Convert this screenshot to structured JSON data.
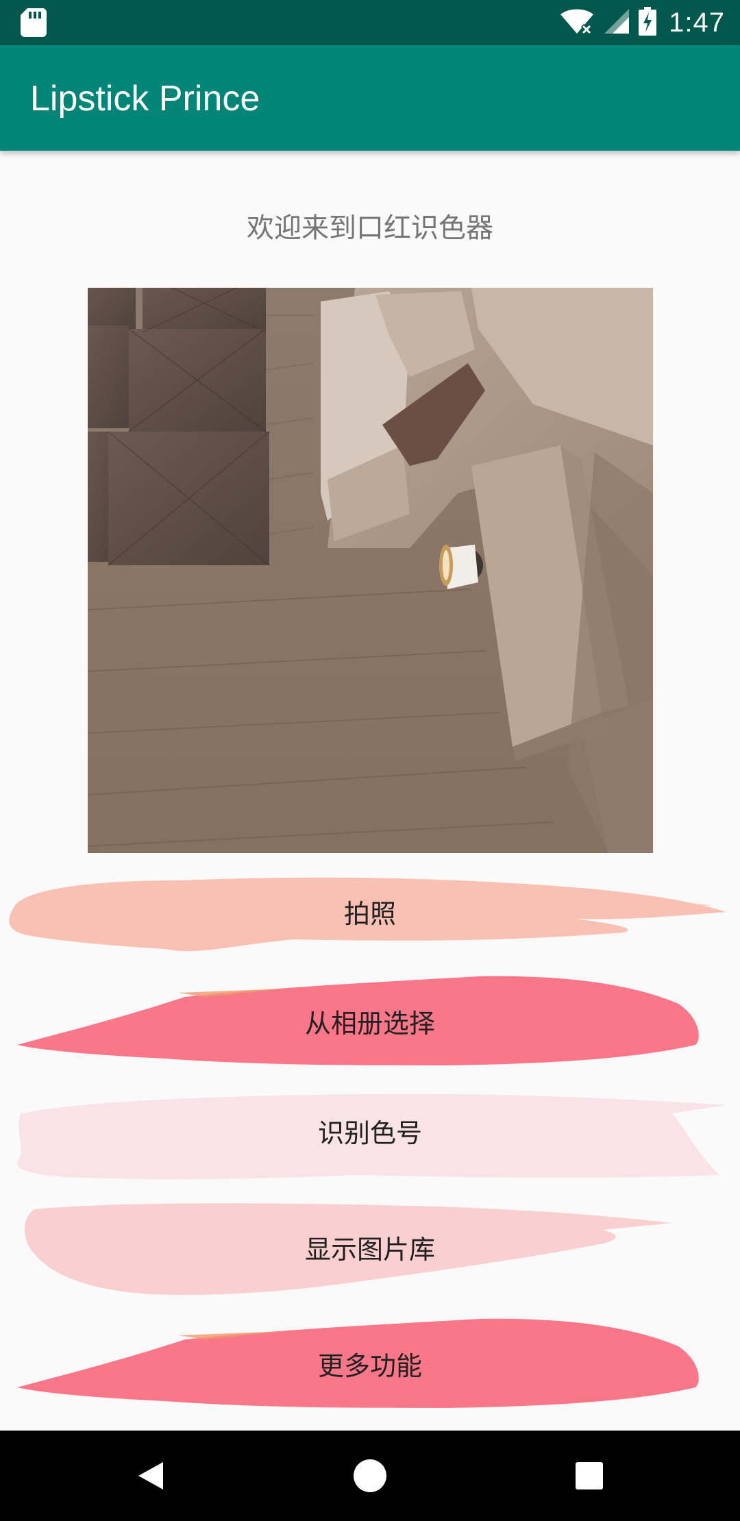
{
  "status_bar": {
    "time": "1:47",
    "icons": [
      "sd-card-icon",
      "wifi-icon",
      "signal-icon",
      "battery-charging-icon"
    ]
  },
  "app_bar": {
    "title": "Lipstick Prince"
  },
  "main": {
    "welcome_text": "欢迎来到口红识色器",
    "buttons": [
      {
        "label": "拍照",
        "color": "#F9C1B3"
      },
      {
        "label": "从相册选择",
        "color": "#F97789"
      },
      {
        "label": "识别色号",
        "color": "#F9E3E8"
      },
      {
        "label": "显示图片库",
        "color": "#F9CFCF"
      },
      {
        "label": "更多功能",
        "color": "#F97789"
      }
    ]
  },
  "nav_bar": {
    "icons": [
      "back-icon",
      "home-icon",
      "recents-icon"
    ]
  }
}
